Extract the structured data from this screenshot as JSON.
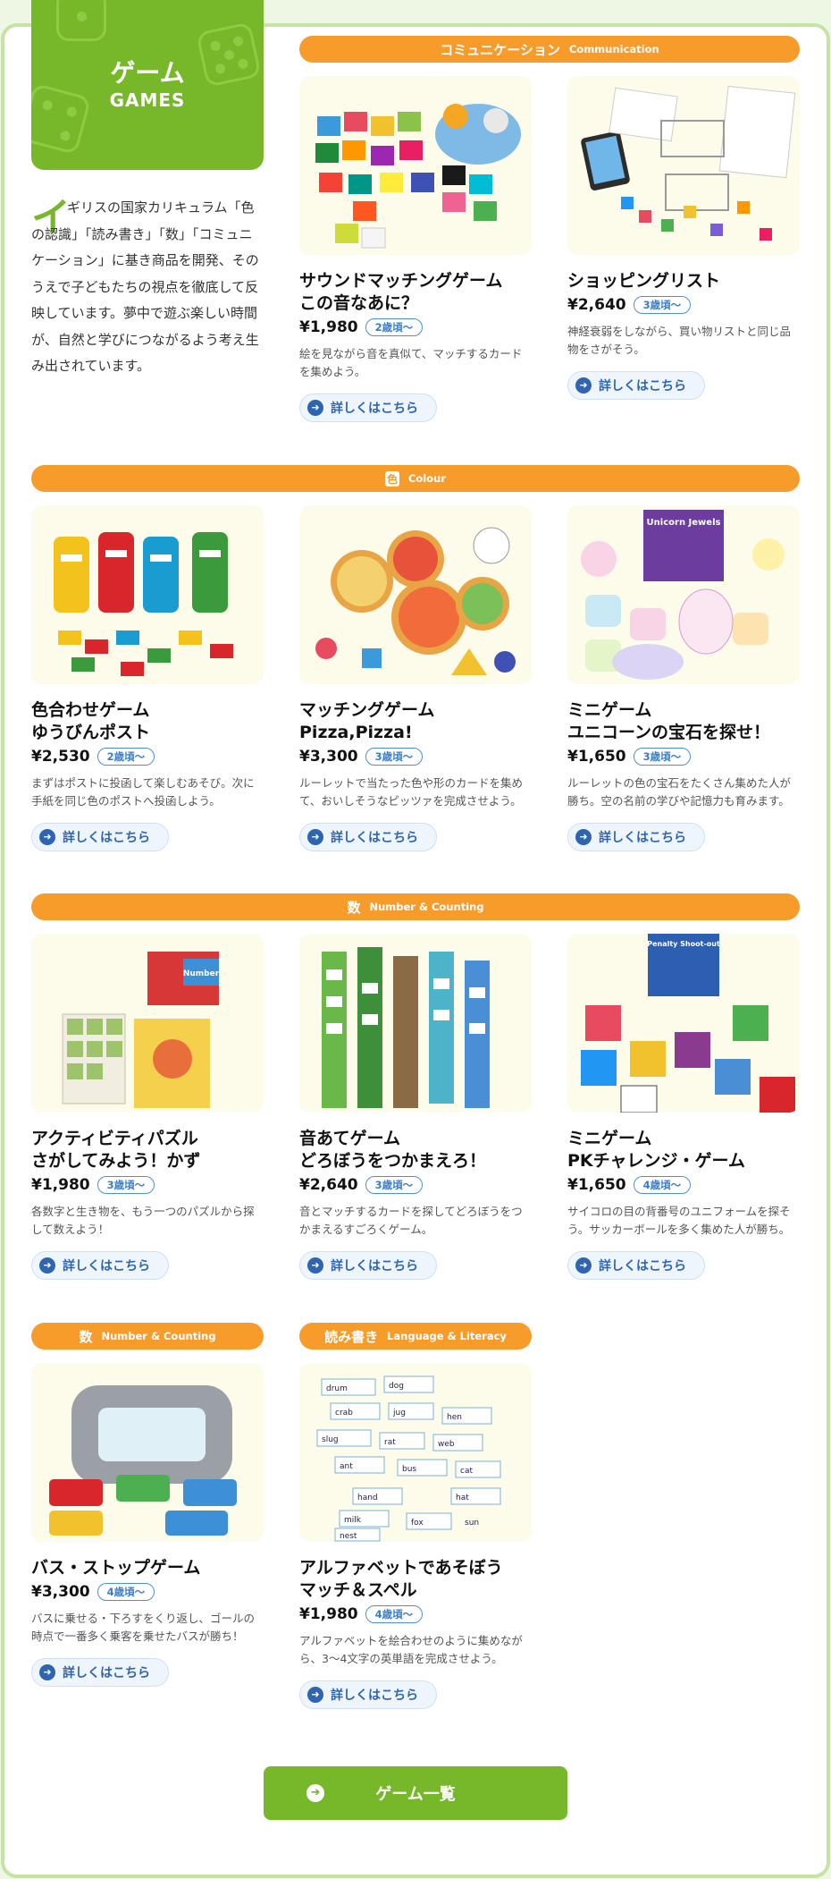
{
  "header": {
    "title": "ゲーム",
    "subtitle": "GAMES",
    "intro_initial": "イ",
    "intro": "ギリスの国家カリキュラム「色の認識」「読み書き」「数」「コミュニケーション」に基き商品を開発、そのうえで子どもたちの視点を徹底して反映しています。夢中で遊ぶ楽しい時間が、自然と学びにつながるよう考え生み出されています。"
  },
  "categories": {
    "communication": {
      "jp": "コミュニケーション",
      "en": "Communication"
    },
    "colour": {
      "icon": "色",
      "en": "Colour"
    },
    "number": {
      "icon": "数",
      "en": "Number & Counting"
    },
    "number2": {
      "icon": "数",
      "en": "Number & Counting"
    },
    "literacy": {
      "jp": "読み書き",
      "en": "Language & Literacy"
    }
  },
  "products": [
    {
      "name": "サウンドマッチングゲーム\nこの音なあに？",
      "price": "¥1,980",
      "age": "2歳頃〜",
      "desc": "絵を見ながら音を真似て、マッチするカードを集めよう。",
      "more": "詳しくはこちら"
    },
    {
      "name": "ショッピングリスト",
      "price": "¥2,640",
      "age": "3歳頃〜",
      "desc": "神経衰弱をしながら、買い物リストと同じ品物をさがそう。",
      "more": "詳しくはこちら"
    },
    {
      "name": "色合わせゲーム\nゆうびんポスト",
      "price": "¥2,530",
      "age": "2歳頃〜",
      "desc": "まずはポストに投函して楽しむあそび。次に手紙を同じ色のポストへ投函しよう。",
      "more": "詳しくはこちら"
    },
    {
      "name": "マッチングゲーム\nPizza,Pizza!",
      "price": "¥3,300",
      "age": "3歳頃〜",
      "desc": "ルーレットで当たった色や形のカードを集めて、おいしそうなピッツァを完成させよう。",
      "more": "詳しくはこちら"
    },
    {
      "name": "ミニゲーム\nユニコーンの宝石を探せ！",
      "price": "¥1,650",
      "age": "3歳頃〜",
      "desc": "ルーレットの色の宝石をたくさん集めた人が勝ち。空の名前の学びや記憶力も育みます。",
      "more": "詳しくはこちら"
    },
    {
      "name": "アクティビティパズル\nさがしてみよう！かず",
      "price": "¥1,980",
      "age": "3歳頃〜",
      "desc": "各数字と生き物を、もう一つのパズルから探して数えよう！",
      "more": "詳しくはこちら"
    },
    {
      "name": "音あてゲーム\nどろぼうをつかまえろ！",
      "price": "¥2,640",
      "age": "3歳頃〜",
      "desc": "音とマッチするカードを探してどろぼうをつかまえるすごろくゲーム。",
      "more": "詳しくはこちら"
    },
    {
      "name": "ミニゲーム\nPKチャレンジ・ゲーム",
      "price": "¥1,650",
      "age": "4歳頃〜",
      "desc": "サイコロの目の背番号のユニフォームを探そう。サッカーボールを多く集めた人が勝ち。",
      "more": "詳しくはこちら"
    },
    {
      "name": "バス・ストップゲーム",
      "price": "¥3,300",
      "age": "4歳頃〜",
      "desc": "バスに乗せる・下ろすをくり返し、ゴールの時点で一番多く乗客を乗せたバスが勝ち！",
      "more": "詳しくはこちら"
    },
    {
      "name": "アルファベットであそぼう\nマッチ＆スペル",
      "price": "¥1,980",
      "age": "4歳頃〜",
      "desc": "アルファベットを絵合わせのように集めながら、3〜4文字の英単語を完成させよう。",
      "more": "詳しくはこちら"
    }
  ],
  "image_text": {
    "unicorn_box": "Unicorn Jewels",
    "number_box": "Number",
    "penalty_box": "Penalty Shoot-out",
    "words": [
      "drum",
      "dog",
      "crab",
      "jug",
      "hen",
      "slug",
      "rat",
      "web",
      "ant",
      "bus",
      "cat",
      "hat",
      "hand",
      "fox",
      "milk",
      "sun",
      "nest"
    ]
  },
  "footer": {
    "button": "ゲーム一覧"
  }
}
